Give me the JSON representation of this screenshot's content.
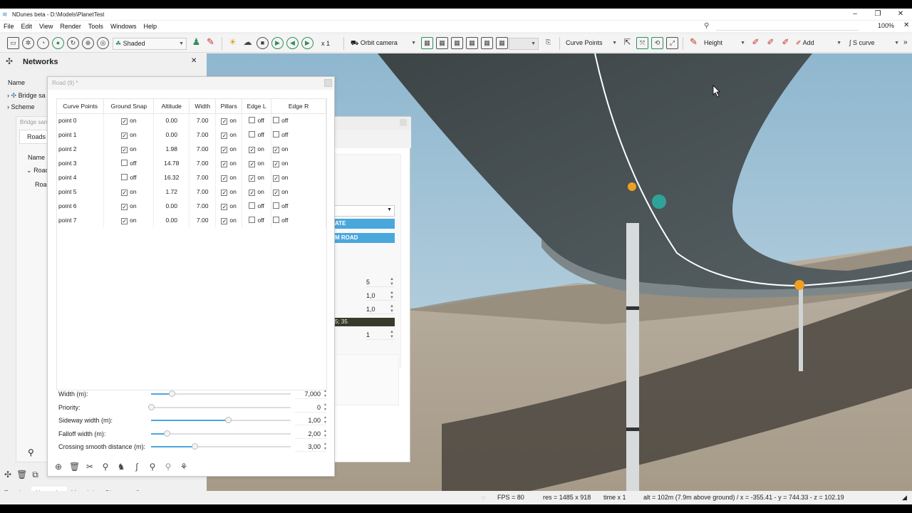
{
  "window": {
    "title": "NDunes beta - D:\\Models\\PlanetTest",
    "controls": [
      "–",
      "❐",
      "✕"
    ]
  },
  "menu": {
    "items": [
      "File",
      "Edit",
      "View",
      "Render",
      "Tools",
      "Windows",
      "Help"
    ],
    "zoom": "100%"
  },
  "toolbar": {
    "shading": "Shaded",
    "speed": "x 1",
    "camera": "Orbit camera",
    "edit_mode": "Curve Points",
    "height_mode": "Height",
    "add_label": "Add",
    "curve_type": "S curve"
  },
  "left_panel": {
    "title": "Networks",
    "name_header": "Name",
    "tree_item_1": "Bridge sa",
    "tree_item_2": "Scheme",
    "bridge_window_title": "Bridge sam",
    "roads_tab": "Roads",
    "roads_name_header": "Name",
    "roads_item": "Road",
    "roads_subitem": "Road",
    "bottom_tabs": [
      "Terrains",
      "Networks",
      "Materials",
      "Biomes",
      "Scenes"
    ],
    "active_tab": "Networks"
  },
  "road_dialog": {
    "title": "Road (9) *",
    "columns": [
      "Curve Points",
      "Ground Snap",
      "Altitude",
      "Width",
      "Pillars",
      "Edge L",
      "Edge R"
    ],
    "rows": [
      {
        "name": "point 0",
        "snap": true,
        "snap_label": "on",
        "alt": "0.00",
        "width": "7.00",
        "pillars": true,
        "pillars_label": "on",
        "edge_l": false,
        "edge_l_label": "off",
        "edge_r": false,
        "edge_r_label": "off"
      },
      {
        "name": "point 1",
        "snap": true,
        "snap_label": "on",
        "alt": "0.00",
        "width": "7.00",
        "pillars": true,
        "pillars_label": "on",
        "edge_l": false,
        "edge_l_label": "off",
        "edge_r": false,
        "edge_r_label": "off"
      },
      {
        "name": "point 2",
        "snap": true,
        "snap_label": "on",
        "alt": "1.98",
        "width": "7.00",
        "pillars": true,
        "pillars_label": "on",
        "edge_l": true,
        "edge_l_label": "on",
        "edge_r": true,
        "edge_r_label": "on"
      },
      {
        "name": "point 3",
        "snap": false,
        "snap_label": "off",
        "alt": "14.78",
        "width": "7.00",
        "pillars": true,
        "pillars_label": "on",
        "edge_l": true,
        "edge_l_label": "on",
        "edge_r": true,
        "edge_r_label": "on"
      },
      {
        "name": "point 4",
        "snap": false,
        "snap_label": "off",
        "alt": "16.32",
        "width": "7.00",
        "pillars": true,
        "pillars_label": "on",
        "edge_l": true,
        "edge_l_label": "on",
        "edge_r": true,
        "edge_r_label": "on"
      },
      {
        "name": "point 5",
        "snap": true,
        "snap_label": "on",
        "alt": "1.72",
        "width": "7.00",
        "pillars": true,
        "pillars_label": "on",
        "edge_l": true,
        "edge_l_label": "on",
        "edge_r": true,
        "edge_r_label": "on"
      },
      {
        "name": "point 6",
        "snap": true,
        "snap_label": "on",
        "alt": "0.00",
        "width": "7.00",
        "pillars": true,
        "pillars_label": "on",
        "edge_l": false,
        "edge_l_label": "off",
        "edge_r": false,
        "edge_r_label": "off"
      },
      {
        "name": "point 7",
        "snap": true,
        "snap_label": "on",
        "alt": "0.00",
        "width": "7.00",
        "pillars": true,
        "pillars_label": "on",
        "edge_l": false,
        "edge_l_label": "off",
        "edge_r": false,
        "edge_r_label": "off"
      }
    ],
    "props": [
      {
        "label": "Width (m):",
        "value": "7,000",
        "level": 0.15
      },
      {
        "label": "Priority:",
        "value": "0",
        "level": 0.0
      },
      {
        "label": "Sideway width (m):",
        "value": "1,00",
        "level": 0.55
      },
      {
        "label": "Falloff width (m):",
        "value": "2,00",
        "level": 0.11
      },
      {
        "label": "Crossing smooth distance (m):",
        "value": "3,00",
        "level": 0.31
      }
    ]
  },
  "bg_dialog": {
    "btn1": "ATE",
    "btn2": "M ROAD",
    "val1": "5",
    "val2": "1,0",
    "val3": "1,0",
    "dark_value": "5; 35",
    "val4": "1"
  },
  "status": {
    "fps": "FPS = 80",
    "res": "res = 1485 x 918",
    "time": "time x 1",
    "coords": "alt = 102m (7.9m above ground) / x = -355.41 - y = 744.33 - z = 102.19"
  },
  "colors": {
    "accent": "#4aa7dc",
    "control_point": "#f0a020",
    "selection_marker": "#2fa39a"
  }
}
